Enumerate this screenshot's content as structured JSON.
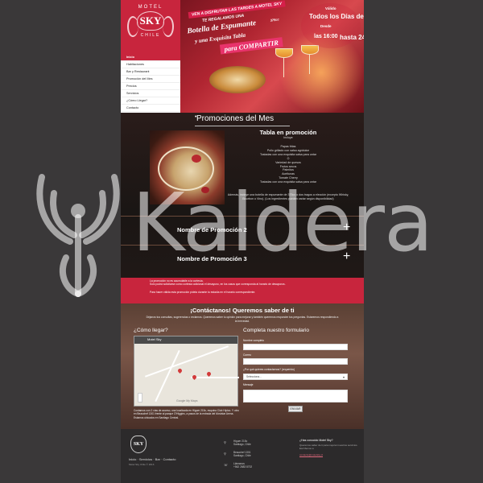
{
  "logo": {
    "top": "MOTEL",
    "name": "SKY",
    "bottom": "CHILE"
  },
  "menu": {
    "items": [
      "Inicio",
      "Habitaciones",
      "Bar y Restaurant",
      "Promoción del Mes",
      "Precios",
      "Servicios",
      "¿Cómo Llegar?",
      "Contacto"
    ],
    "active_index": 0
  },
  "banner": {
    "line1": "VEN A DISFRUTAR LAS TARDES A MOTEL SKY",
    "line2": "TE REGALAMOS UNA",
    "line3": "Botella de Espumante",
    "size": "375cc",
    "line4": "y una Exquisita Tabla",
    "line5": "para COMPARTIR",
    "hours_valid": "Válido",
    "hours_days": "Todos los Días de la semana",
    "hours_from": "Desde",
    "hours_start": "las 16:00",
    "hours_end": "hasta 24:00 hrs."
  },
  "promos": {
    "title": "Promociones del Mes",
    "promo1_title": "Tabla en promoción",
    "promo1_includes": "Incluye",
    "promo1_items": [
      "Papas fritas",
      "Pollo grillado con salsa agridulce",
      "Tostadas con una exquisita salsa para untar",
      "O",
      "Variedad de quesos",
      "Frutos secos",
      "Palmitos",
      "Aceitunas",
      "Tomate Cherry",
      "Tostadas con una exquisita salsa para untar"
    ],
    "promo1_extra": "Además, incluye una botella de espumante de 375cc o dos tragos a elección (excepto Whisky, Bourbon o Vino). (Los ingredientes pueden variar según disponibilidad)",
    "promo2_title": "Nombre de Promoción 2",
    "promo3_title": "Nombre de Promoción 3",
    "plus_glyph": "+"
  },
  "notice": {
    "line1": "La promoción no es acumulable a la cortesía.",
    "line2": "Solo podrá solicitarse como cortesía adicional el desayuno, en los casos que corresponda al horario de desayunos.",
    "line3": "Para hacer válida esta promoción pídela durante tu estadía en el horario correspondiente."
  },
  "contact": {
    "title": "¡Contáctanos! Queremos saber de ti",
    "subtitle": "Déjanos tus consultas, sugerencias o reclamos. Queremos saber tu opinión para mejorar y también queremos responder tus preguntas. Estaremos respondiendo a la brevedad.",
    "how_title": "¿Cómo llegar?",
    "map_title": "Motel Sky",
    "map_google": "Google My Maps",
    "map_note": "Contamos con 2 vías de acceso, una localizada en Higuer 215c, esquina Club Hípico. Y otra en Beauchef 1301 frente al parque O'Higgins, a pasos de la entrada del Movistar Arena. Estamos ubicados en Santiago Central.",
    "form_title": "Completa nuestro formulario",
    "label_name": "Nombre completo",
    "label_email": "Correo",
    "label_reason": "¿Por qué quieres contactarnos? (requerido)",
    "select_value": "Selecciona...",
    "label_message": "Mensaje",
    "submit_label": "ENVIAR"
  },
  "footer": {
    "logo": "SKY",
    "links": "Inicio · Servicios · Bar · Contacto",
    "copy": "Motel Sky Chile © 2016",
    "addr1_a": "Higuer 215c",
    "addr1_b": "Santiago, Chile",
    "addr2_a": "Beauchef 1301",
    "addr2_b": "Santiago, Chile",
    "phone_label": "Llámanos",
    "phone": "+562 2683 8702",
    "qs_title": "¿Has conocido Motel Sky?",
    "qs_text": "Queremos saber de ti para mejorar nuestros servicios. Escríbenos a",
    "qs_link": "contacto@motelsky.cl"
  },
  "watermark": {
    "text": "Kaldera"
  },
  "icons": {
    "pin": "map-pin-icon",
    "phone": "phone-icon",
    "phoenix": "phoenix-logo-icon"
  },
  "colors": {
    "brand_red": "#c8253d",
    "page_bg": "#3a3839",
    "footer_bg": "#2c2a2b"
  }
}
